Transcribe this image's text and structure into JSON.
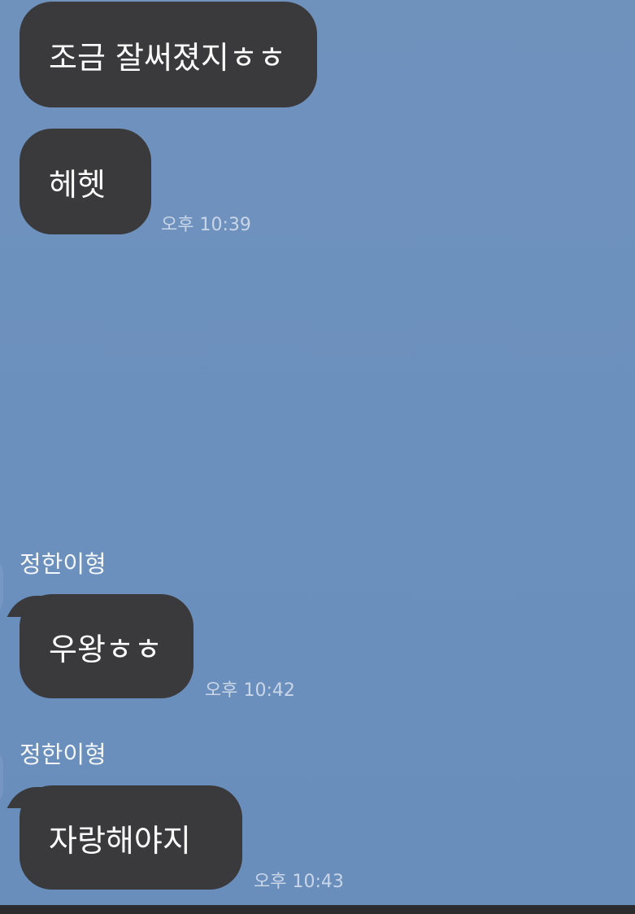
{
  "messages": [
    {
      "text": "조금 잘써졌지ㅎㅎ",
      "time": ""
    },
    {
      "text": "헤헷",
      "time": "오후 10:39"
    },
    {
      "sender": "정한이형",
      "text": "우왕ㅎㅎ",
      "time": "오후 10:42"
    },
    {
      "sender": "정한이형",
      "text": "자랑해야지",
      "time": "오후 10:43"
    }
  ]
}
